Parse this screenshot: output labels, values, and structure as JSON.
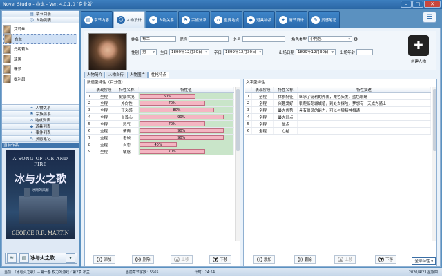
{
  "window": {
    "title": "Novel Studio - 小说 - Ver: 4.0.1.0 [专业版]"
  },
  "sidebar": {
    "nav_top": [
      {
        "label": "章节目录",
        "icon": "book-icon"
      },
      {
        "label": "人物列表",
        "icon": "people-icon"
      }
    ],
    "characters": [
      {
        "name": "艾莉丝"
      },
      {
        "name": "布兰"
      },
      {
        "name": "丹妮莉丝"
      },
      {
        "name": "琼恩"
      },
      {
        "name": "珊莎"
      },
      {
        "name": "提利昂"
      }
    ],
    "nav_bottom": [
      {
        "label": "人物关系",
        "icon": "relation-icon"
      },
      {
        "label": "宗族派系",
        "icon": "clan-icon"
      },
      {
        "label": "地点列表",
        "icon": "place-icon"
      },
      {
        "label": "道具列表",
        "icon": "item-icon"
      },
      {
        "label": "事件列表",
        "icon": "event-icon"
      },
      {
        "label": "灵感笔记",
        "icon": "note-icon"
      }
    ],
    "current_work_label": "当前作品",
    "cover": {
      "en": "A SONG OF ICE AND FIRE",
      "cn": "冰与火之歌",
      "sub": "—— 冰雨的风暴 ——",
      "author": "GEORGE R.R. MARTIN"
    },
    "work_name": "冰与火之歌"
  },
  "tabs": [
    {
      "label": "章节内容"
    },
    {
      "label": "人物设计"
    },
    {
      "label": "人物关系"
    },
    {
      "label": "宗族派系"
    },
    {
      "label": "重要地点"
    },
    {
      "label": "道具物品"
    },
    {
      "label": "情节设计"
    },
    {
      "label": "灵感笔记"
    }
  ],
  "character": {
    "name_label": "姓名",
    "name": "布兰",
    "nick_label": "昵称",
    "nick": "",
    "alias_label": "外号",
    "alias": "",
    "role_label": "角色类型",
    "role": "小角色",
    "gender_label": "性别",
    "gender": "男",
    "birth_label": "生日",
    "birth": "1899年12月30日",
    "death_label": "卒日",
    "death": "1899年12月30日",
    "appear_label": "出场日期",
    "appear": "1899年12月30日",
    "age_label": "出场年龄",
    "age": "",
    "create_label": "创建人物"
  },
  "subtabs": [
    "人物简介",
    "人物自传",
    "人物图片",
    "性格特点"
  ],
  "numeric": {
    "caption": "数值型特性（百分值）",
    "headers": [
      "表现阶段",
      "特性名称",
      "特性值"
    ],
    "rows": [
      {
        "no": "1",
        "stage": "全程",
        "name": "健康状况",
        "value": 60
      },
      {
        "no": "2",
        "stage": "全程",
        "name": "外向性",
        "value": 70
      },
      {
        "no": "3",
        "stage": "全程",
        "name": "正义感",
        "value": 80
      },
      {
        "no": "4",
        "stage": "全程",
        "name": "自尊心",
        "value": 90
      },
      {
        "no": "5",
        "stage": "全程",
        "name": "怒气",
        "value": 70
      },
      {
        "no": "6",
        "stage": "全程",
        "name": "情商",
        "value": 90
      },
      {
        "no": "7",
        "stage": "全程",
        "name": "忠诚",
        "value": 90
      },
      {
        "no": "8",
        "stage": "全程",
        "name": "自恋",
        "value": 40
      },
      {
        "no": "9",
        "stage": "全程",
        "name": "敏感",
        "value": 70
      }
    ]
  },
  "text": {
    "caption": "文字型特性",
    "headers": [
      "表现阶段",
      "特性名称",
      "特性描述"
    ],
    "rows": [
      {
        "no": "1",
        "stage": "全程",
        "name": "体貌特征",
        "desc": "继承了徒利的外貌，栗色头发，蓝色眼睛"
      },
      {
        "no": "2",
        "stage": "全程",
        "name": "兴趣爱好",
        "desc": "攀爬临冬城城墙，到处去探险，梦想有一天成为骑士"
      },
      {
        "no": "3",
        "stage": "全程",
        "name": "最大优势",
        "desc": "具有狼灵的能力，可以与狼精神相通"
      },
      {
        "no": "4",
        "stage": "全程",
        "name": "最大弱点",
        "desc": ""
      },
      {
        "no": "5",
        "stage": "全程",
        "name": "优点",
        "desc": ""
      },
      {
        "no": "6",
        "stage": "全程",
        "name": "心结",
        "desc": ""
      }
    ]
  },
  "actions": {
    "add": "添加",
    "delete": "删除",
    "up": "上移",
    "down": "下移",
    "all_props": "全部特性"
  },
  "status": {
    "work": "当前：《冰与火之歌》－第一卷 权力的游戏／第2章 布兰",
    "words": "当前章节字数：5565",
    "timer": "计时：24:54",
    "date": "2020/4/23 星期四"
  }
}
